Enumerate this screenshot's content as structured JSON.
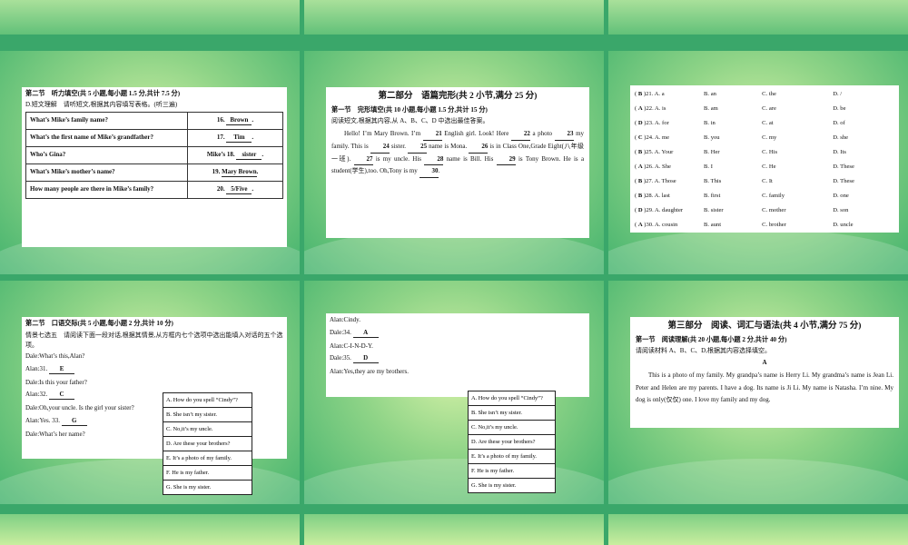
{
  "slide1": {
    "section": "第二节　听力填空(共 5 小题,每小题 1.5 分,共计 7.5 分)",
    "instruction": "D.短文理解　请听短文,根据其内容填写表格。(听三遍)",
    "rows": [
      {
        "q": "What’s Mike’s family name?",
        "n": "16.",
        "ans": "Brown",
        "pre": "",
        "end": "."
      },
      {
        "q": "What’s the first name of Mike’s grandfather?",
        "n": "17.",
        "ans": "Tim",
        "pre": "",
        "end": "."
      },
      {
        "q": "Who’s Gina?",
        "n": "18.",
        "ans": "sister",
        "pre": "Mike’s ",
        "end": "."
      },
      {
        "q": "What’s Mike’s mother’s name?",
        "n": "19.",
        "ans": "Mary Brown",
        "pre": "",
        "end": "."
      },
      {
        "q": "How many people are there in Mike’s family?",
        "n": "20.",
        "ans": "5/Five",
        "pre": "",
        "end": "."
      }
    ]
  },
  "slide2": {
    "title": "第二部分　语篇完形(共 2 小节,满分 25 分)",
    "section": "第一节　完形填空(共 10 小题,每小题 1.5 分,共计 15 分)",
    "instruction": "阅读短文,根据其内容,从 A、B、C、D 中选出最佳答案。",
    "p1": "Hello! I’m Mary Brown. I’m",
    "b21": "21",
    "p2": "English girl. Look! Here",
    "b22": "22",
    "p3": "a photo",
    "b23": "23",
    "p4": "my family. This is",
    "b24": "24",
    "p5": "sister.",
    "b25": "25",
    "p6": "name is Mona.",
    "b26": "26",
    "p7": "is in Class One,Grade Eight(八年级一班).",
    "b27": "27",
    "p8": "is my uncle. His",
    "b28": "28",
    "p9": "name is Bill. His",
    "b29": "29",
    "p10": "is Tony Brown. He is a student(学生),too. Oh,Tony is my",
    "b30": "30",
    "p11": "."
  },
  "slide3": {
    "rows": [
      [
        "B",
        "21",
        "A. a",
        "B. an",
        "C. the",
        "D. /"
      ],
      [
        "A",
        "22",
        "A. is",
        "B. am",
        "C. are",
        "D. be"
      ],
      [
        "D",
        "23",
        "A. for",
        "B. in",
        "C. at",
        "D. of"
      ],
      [
        "C",
        "24",
        "A. me",
        "B. you",
        "C. my",
        "D. she"
      ],
      [
        "B",
        "25",
        "A. Your",
        "B. Her",
        "C. His",
        "D. Its"
      ],
      [
        "A",
        "26",
        "A. She",
        "B. I",
        "C. He",
        "D. These"
      ],
      [
        "B",
        "27",
        "A. Those",
        "B. This",
        "C. It",
        "D. These"
      ],
      [
        "B",
        "28",
        "A. last",
        "B. first",
        "C. family",
        "D. one"
      ],
      [
        "D",
        "29",
        "A. daughter",
        "B. sister",
        "C. mother",
        "D. son"
      ],
      [
        "A",
        "30",
        "A. cousin",
        "B. aunt",
        "C. brother",
        "D. uncle"
      ]
    ]
  },
  "slide4": {
    "section": "第二节　口语交际(共 5 小题,每小题 2 分,共计 10 分)",
    "instruction": "情景七选五　请阅读下面一段对话,根据其情景,从方框内七个选项中选出能填入对话的五个选项。",
    "lines": [
      {
        "t": "Dale:What’s this,Alan?"
      },
      {
        "t": "Alan:31.",
        "ans": "E"
      },
      {
        "t": "Dale:Is this your father?"
      },
      {
        "t": "Alan:32.",
        "ans": "C"
      },
      {
        "t": "Dale:Oh,your uncle. Is the girl your sister?"
      },
      {
        "t": "Alan:Yes. 33.",
        "ans": "G"
      },
      {
        "t": "Dale:What’s her name?"
      }
    ]
  },
  "options": [
    "A. How do you spell “Cindy”?",
    "B. She isn’t my sister.",
    "C. No,it’s my uncle.",
    "D. Are these your brothers?",
    "E. It’s a photo of my family.",
    "F. He is my father.",
    "G. She is my sister."
  ],
  "slide5": {
    "lines": [
      {
        "t": "Alan:Cindy."
      },
      {
        "t": "Dale:34.",
        "ans": "A"
      },
      {
        "t": "Alan:C-I-N-D-Y."
      },
      {
        "t": "Dale:35.",
        "ans": "D"
      },
      {
        "t": "Alan:Yes,they are my brothers."
      }
    ]
  },
  "slide6": {
    "title": "第三部分　阅读、词汇与语法(共 4 小节,满分 75 分)",
    "section": "第一节　阅读理解(共 20 小题,每小题 2 分,共计 40 分)",
    "instruction": "请阅读材料 A、B、C、D,根据其内容选择填空。",
    "label": "A",
    "text": "This is a photo of my family. My grandpa’s name is Herry Li. My grandma’s name is Jean Li. Peter and Helen are my parents. I have a dog. Its name is Ji Li. My name is Natasha. I’m nine. My dog is only(仅仅) one. I love my family and my dog."
  }
}
